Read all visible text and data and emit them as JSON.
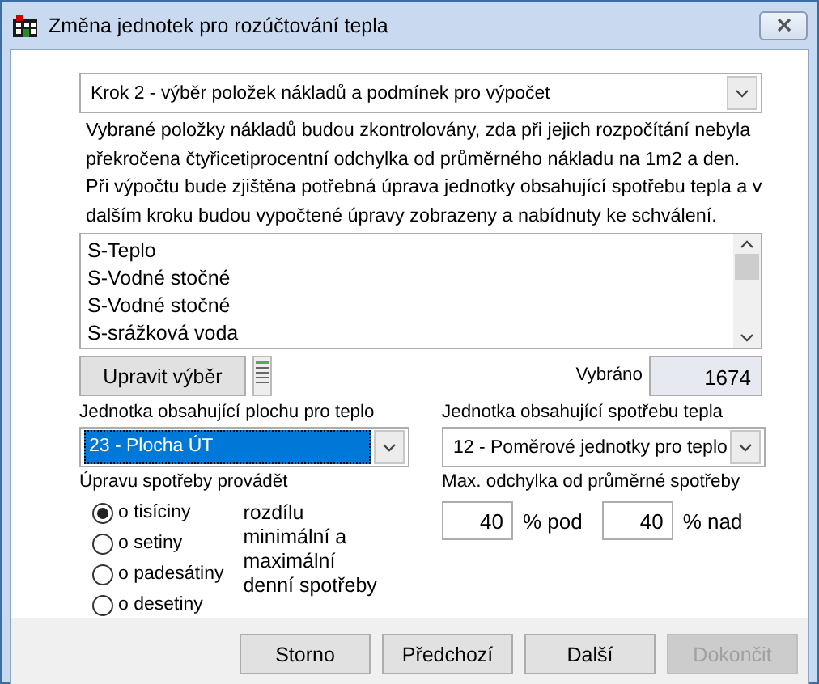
{
  "window": {
    "title": "Změna jednotek pro rozúčtování tepla"
  },
  "step": {
    "value": "Krok 2 - výběr položek nákladů a podmínek pro výpočet"
  },
  "description": "Vybrané položky nákladů budou zkontrolovány, zda při jejich rozpočítání nebyla překročena čtyřicetiprocentní odchylka od průměrného nákladu na 1m2 a den. Při výpočtu bude zjištěna potřebná úprava jednotky obsahující spotřebu tepla a v dalším kroku budou vypočtené úpravy zobrazeny a nabídnuty ke schválení.",
  "cost_items": [
    "S-Teplo",
    "S-Vodné stočné",
    "S-Vodné stočné",
    "S-srážková voda"
  ],
  "edit_selection_button": "Upravit výběr",
  "selected_count": {
    "label": "Vybráno",
    "value": "1674"
  },
  "area_unit": {
    "label": "Jednotka obsahující plochu pro teplo",
    "value": "23 - Plocha ÚT",
    "highlighted": true
  },
  "consumption_unit": {
    "label": "Jednotka obsahující spotřebu tepla",
    "value": "12 - Poměrové jednotky pro teplo",
    "highlighted": false
  },
  "adjustment": {
    "label": "Úpravu spotřeby provádět",
    "options": [
      {
        "label": "o tisíciny",
        "selected": true
      },
      {
        "label": "o setiny",
        "selected": false
      },
      {
        "label": "o padesátiny",
        "selected": false
      },
      {
        "label": "o desetiny",
        "selected": false
      }
    ],
    "note": "rozdílu minimální a maximální denní spotřeby"
  },
  "max_deviation": {
    "label": "Max. odchylka od průměrné spotřeby",
    "below": "40",
    "below_unit": "% pod",
    "above": "40",
    "above_unit": "% nad"
  },
  "buttons": [
    {
      "label": "Storno",
      "disabled": false
    },
    {
      "label": "Předchozí",
      "disabled": false
    },
    {
      "label": "Další",
      "disabled": false
    },
    {
      "label": "Dokončit",
      "disabled": true
    }
  ]
}
